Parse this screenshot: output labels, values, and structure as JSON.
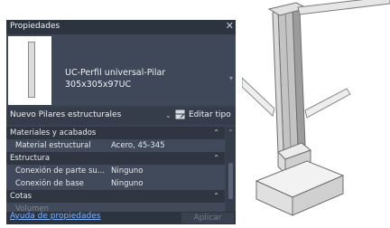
{
  "panel": {
    "title": "Propiedades",
    "close_glyph": "✕",
    "type_name": "UC-Perfil universal-Pilar\n305x305x97UC",
    "type_selector": "Nuevo Pilares estructurales",
    "edit_type_label": "Editar tipo",
    "help_link": "Ayuda de propiedades",
    "apply_button": "Aplicar"
  },
  "rows": [
    {
      "type": "category",
      "label": "Materiales y acabados",
      "toggle": "⌃"
    },
    {
      "type": "property",
      "label": "Material estructural",
      "value": "Acero, 45-345"
    },
    {
      "type": "category",
      "label": "Estructura",
      "toggle": "⌃"
    },
    {
      "type": "property",
      "label": "Conexión de parte su...",
      "value": "Ninguno"
    },
    {
      "type": "property",
      "label": "Conexión de base",
      "value": "Ninguno"
    },
    {
      "type": "category",
      "label": "Cotas",
      "toggle": "⌃"
    },
    {
      "type": "property",
      "label": "Volumen",
      "value": "",
      "dim": true
    }
  ],
  "icons": {
    "close": "close-icon",
    "dropdown": "chevron-down-icon",
    "edit_type": "edit-type-icon",
    "collapse": "collapse-icon",
    "scroll_up": "scroll-up-icon",
    "scroll_down": "scroll-down-icon"
  }
}
